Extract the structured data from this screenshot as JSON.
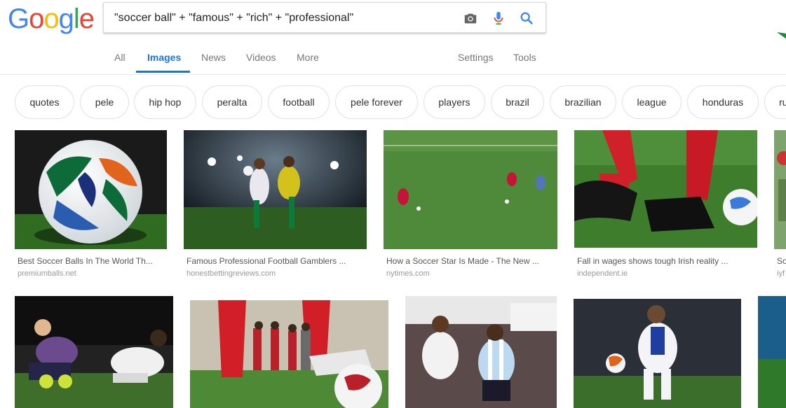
{
  "logo": {
    "letters": [
      "G",
      "o",
      "o",
      "g",
      "l",
      "e"
    ],
    "colors": [
      "#4285f4",
      "#ea4335",
      "#fbbc05",
      "#4285f4",
      "#34a853",
      "#ea4335"
    ]
  },
  "search": {
    "query": "\"soccer ball\" + \"famous\" + \"rich\" + \"professional\"",
    "icons": [
      "camera-icon",
      "mic-icon",
      "search-icon"
    ]
  },
  "nav": {
    "tabs": [
      "All",
      "Images",
      "News",
      "Videos",
      "More"
    ],
    "active": "Images",
    "settings": "Settings",
    "tools": "Tools"
  },
  "chips": [
    "quotes",
    "pele",
    "hip hop",
    "peralta",
    "football",
    "pele forever",
    "players",
    "brazil",
    "brazilian",
    "league",
    "honduras",
    "ru"
  ],
  "results_row1": [
    {
      "caption": "Best Soccer Balls In The World Th...",
      "source": "premiumballs.net"
    },
    {
      "caption": "Famous Professional Football Gamblers ...",
      "source": "honestbettingreviews.com"
    },
    {
      "caption": "How a Soccer Star Is Made - The New ...",
      "source": "nytimes.com"
    },
    {
      "caption": "Fall in wages shows tough Irish reality ...",
      "source": "independent.ie"
    },
    {
      "caption": "So",
      "source": "iyf"
    }
  ],
  "colors": {
    "accent": "#1a73e8",
    "chip_border": "#dfe1e5",
    "grass": "#3f7a2a"
  }
}
